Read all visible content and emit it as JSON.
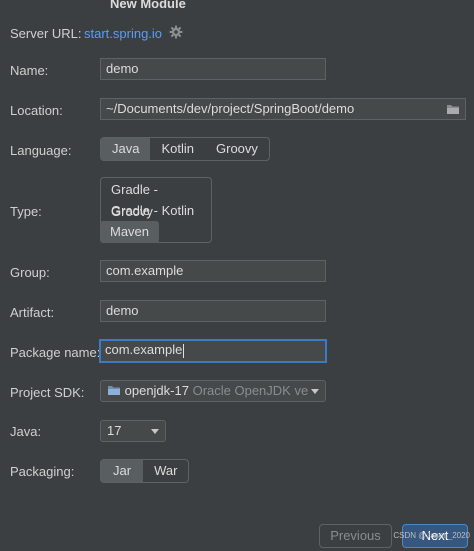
{
  "dialog": {
    "title": "New Module"
  },
  "server": {
    "label": "Server URL:",
    "url": "start.spring.io",
    "settings_icon": "gear-icon"
  },
  "name": {
    "label": "Name:",
    "value": "demo"
  },
  "location": {
    "label": "Location:",
    "value": "~/Documents/dev/project/SpringBoot/demo",
    "browse_icon": "folder-icon"
  },
  "language": {
    "label": "Language:",
    "options": [
      "Java",
      "Kotlin",
      "Groovy"
    ],
    "selected": "Java"
  },
  "type": {
    "label": "Type:",
    "options": [
      "Gradle - Groovy",
      "Gradle - Kotlin",
      "Maven"
    ],
    "selected": "Maven"
  },
  "group": {
    "label": "Group:",
    "value": "com.example"
  },
  "artifact": {
    "label": "Artifact:",
    "value": "demo"
  },
  "package_name": {
    "label": "Package name:",
    "value": "com.example"
  },
  "project_sdk": {
    "label": "Project SDK:",
    "name": "openjdk-17",
    "vendor": "Oracle OpenJDK ve"
  },
  "java": {
    "label": "Java:",
    "value": "17"
  },
  "packaging": {
    "label": "Packaging:",
    "options": [
      "Jar",
      "War"
    ],
    "selected": "Jar"
  },
  "buttons": {
    "previous": "Previous",
    "next": "Next"
  },
  "watermark": "CSDN @Jason_2020",
  "colors": {
    "background": "#3c3f41",
    "link": "#589df6",
    "focus": "#3d7ac4",
    "primary_button": "#365880"
  }
}
